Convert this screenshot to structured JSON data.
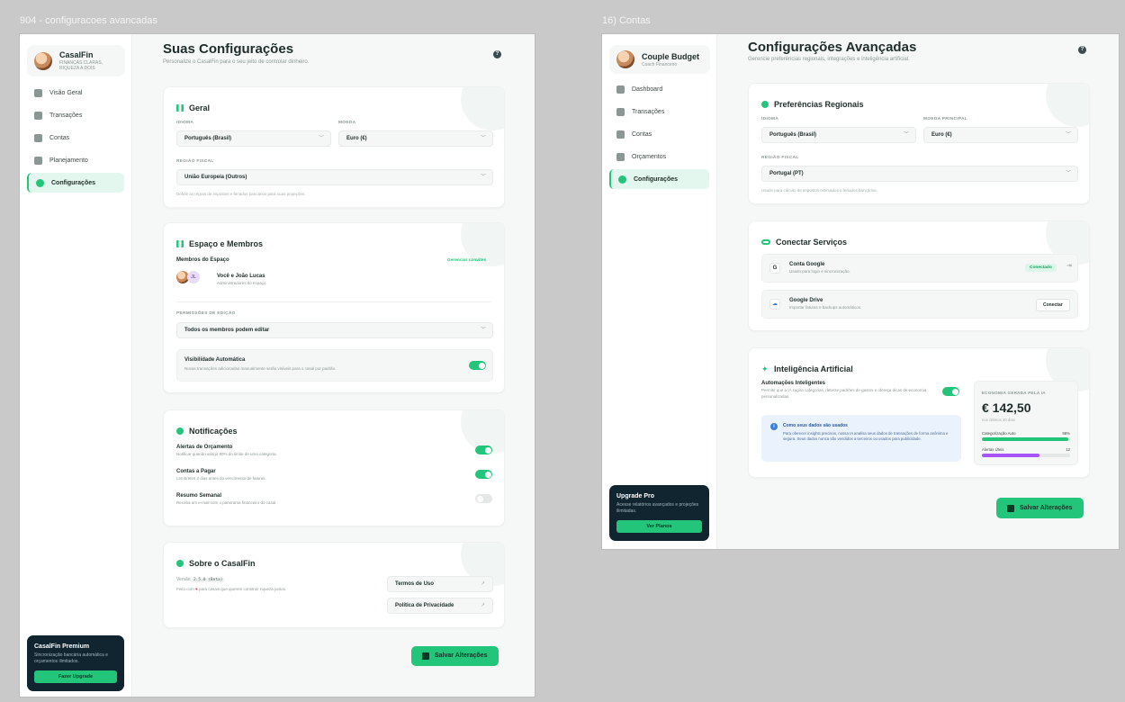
{
  "frame1": {
    "label": "904 - configuracoes avancadas",
    "brand": {
      "name": "CasalFin",
      "tagline": "FINANÇAS CLARAS, RIQUEZA A DOIS"
    },
    "nav": [
      {
        "label": "Visão Geral",
        "active": false
      },
      {
        "label": "Transações",
        "active": false
      },
      {
        "label": "Contas",
        "active": false
      },
      {
        "label": "Planejamento",
        "active": false
      },
      {
        "label": "Configurações",
        "active": true
      }
    ],
    "upgrade": {
      "title": "CasalFin Premium",
      "desc": "Sincronização bancária automática e orçamentos ilimitados.",
      "button": "Fazer Upgrade"
    },
    "title": "Suas Configurações",
    "subtitle": "Personalize o CasalFin para o seu jeito de controlar dinheiro.",
    "help": "?",
    "geral": {
      "title": "Geral",
      "idioma_label": "IDIOMA",
      "idioma_value": "Português (Brasil)",
      "moeda_label": "MOEDA",
      "moeda_value": "Euro (€)",
      "regiao_label": "REGIÃO FISCAL",
      "regiao_value": "União Europeia (Outros)",
      "regiao_hint": "Define as regras de impostos e feriados bancários para suas projeções."
    },
    "espaco": {
      "title": "Espaço e Membros",
      "members_label": "Membros do Espaço",
      "manage_link": "Gerenciar convites",
      "member_initial": "JL",
      "member_name": "Você e João Lucas",
      "member_role": "Administradores do espaço",
      "perm_label": "PERMISSÕES DE EDIÇÃO",
      "perm_value": "Todos os membros podem editar",
      "vis_title": "Visibilidade Automática",
      "vis_desc": "Novas transações adicionadas manualmente serão visíveis para o casal por padrão.",
      "vis_on": true
    },
    "notificacoes": {
      "title": "Notificações",
      "items": [
        {
          "title": "Alertas de Orçamento",
          "desc": "Notificar quando atingir 80% do limite de uma categoria.",
          "on": true
        },
        {
          "title": "Contas a Pagar",
          "desc": "Lembretes 2 dias antes do vencimento de faturas.",
          "on": true
        },
        {
          "title": "Resumo Semanal",
          "desc": "Receba um e-mail com o panorama financeiro do casal.",
          "on": false
        }
      ]
    },
    "sobre": {
      "title": "Sobre o CasalFin",
      "version_label": "Versão",
      "version_value": "2.5.0 (Beta)",
      "made_with": "Feito com",
      "made_rest": "para casais que querem construir riqueza juntos.",
      "terms": "Termos de Uso",
      "privacy": "Política de Privacidade"
    },
    "save": "Salvar Alterações"
  },
  "frame2": {
    "label": "16) Contas",
    "brand": {
      "name": "Couple Budget",
      "tagline": "Coach Financeiro"
    },
    "nav": [
      {
        "label": "Dashboard",
        "active": false
      },
      {
        "label": "Transações",
        "active": false
      },
      {
        "label": "Contas",
        "active": false
      },
      {
        "label": "Orçamentos",
        "active": false
      },
      {
        "label": "Configurações",
        "active": true
      }
    ],
    "upgrade": {
      "title": "Upgrade Pro",
      "desc": "Acesse relatórios avançados e projeções ilimitadas.",
      "button": "Ver Planos"
    },
    "title": "Configurações Avançadas",
    "subtitle": "Gerencie preferências regionais, integrações e inteligência artificial.",
    "help": "?",
    "regional": {
      "title": "Preferências Regionais",
      "idioma_label": "IDIOMA",
      "idioma_value": "Português (Brasil)",
      "moeda_label": "MOEDA PRINCIPAL",
      "moeda_value": "Euro (€)",
      "regiao_label": "REGIÃO FISCAL",
      "regiao_value": "Portugal (PT)",
      "regiao_hint": "Usado para cálculo de impostos estimados e feriados bancários."
    },
    "servicos": {
      "title": "Conectar Serviços",
      "google": {
        "title": "Conta Google",
        "desc": "Usado para login e sincronização.",
        "badge": "Conectado"
      },
      "drive": {
        "title": "Google Drive",
        "desc": "Importar faturas e backups automáticos.",
        "button": "Conectar"
      }
    },
    "ia": {
      "title": "Inteligência Artificial",
      "auto_title": "Automações Inteligentes",
      "auto_desc": "Permitir que a IA sugira categorias, detecte padrões de gastos e ofereça dicas de economia personalizadas.",
      "auto_on": true,
      "info_title": "Como seus dados são usados",
      "info_text": "Para oferecer insights precisos, nossa IA analisa seus dados de transações de forma anônima e segura. Seus dados nunca são vendidos a terceiros ou usados para publicidade.",
      "stats": {
        "label": "ECONOMIA GERADA PELA IA",
        "value": "€ 142,50",
        "sub": "nos últimos 30 dias",
        "bars": [
          {
            "label": "Categorização Auto",
            "value": "98%",
            "fraction": 0.98,
            "color": "#22c57a"
          },
          {
            "label": "Alertas Úteis",
            "value": "12",
            "fraction": 0.65,
            "color": "#a855f7"
          }
        ]
      }
    },
    "save": "Salvar Alterações"
  }
}
